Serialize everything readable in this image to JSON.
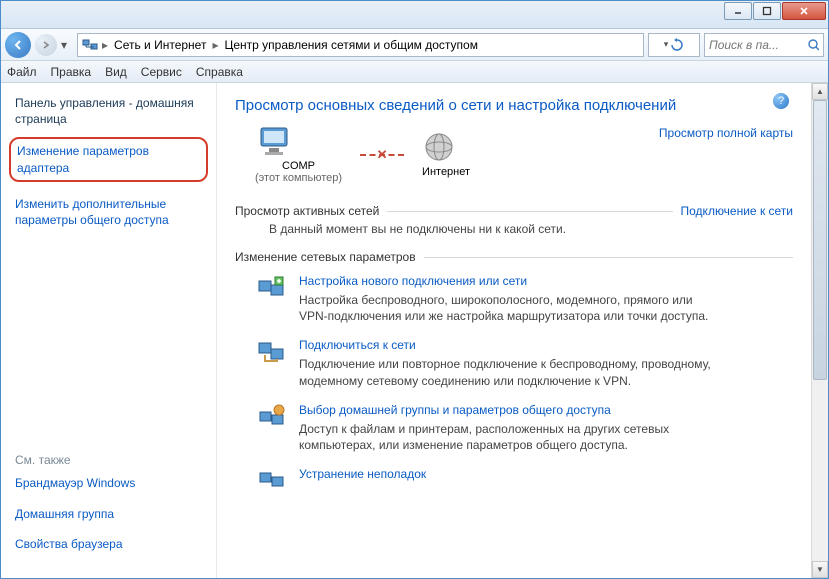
{
  "breadcrumb": {
    "item1": "Сеть и Интернет",
    "item2": "Центр управления сетями и общим доступом"
  },
  "search": {
    "placeholder": "Поиск в па..."
  },
  "menu": {
    "file": "Файл",
    "edit": "Правка",
    "view": "Вид",
    "tools": "Сервис",
    "help": "Справка"
  },
  "sidebar": {
    "home": "Панель управления - домашняя страница",
    "adapter": "Изменение параметров адаптера",
    "advanced": "Изменить дополнительные параметры общего доступа",
    "seealso": "См. также",
    "firewall": "Брандмауэр Windows",
    "homegroup": "Домашняя группа",
    "browser": "Свойства браузера"
  },
  "main": {
    "title": "Просмотр основных сведений о сети и настройка подключений",
    "fullmap": "Просмотр полной карты",
    "node1": {
      "name": "COMP",
      "sub": "(этот компьютер)"
    },
    "node2": {
      "name": "Интернет"
    },
    "active_hdr": "Просмотр активных сетей",
    "connect_link": "Подключение к сети",
    "active_note": "В данный момент вы не подключены ни к какой сети.",
    "change_hdr": "Изменение сетевых параметров",
    "tasks": [
      {
        "title": "Настройка нового подключения или сети",
        "desc": "Настройка беспроводного, широкополосного, модемного, прямого или VPN-подключения или же настройка маршрутизатора или точки доступа."
      },
      {
        "title": "Подключиться к сети",
        "desc": "Подключение или повторное подключение к беспроводному, проводному, модемному сетевому соединению или подключение к VPN."
      },
      {
        "title": "Выбор домашней группы и параметров общего доступа",
        "desc": "Доступ к файлам и принтерам, расположенных на других сетевых компьютерах, или изменение параметров общего доступа."
      },
      {
        "title": "Устранение неполадок",
        "desc": ""
      }
    ]
  }
}
